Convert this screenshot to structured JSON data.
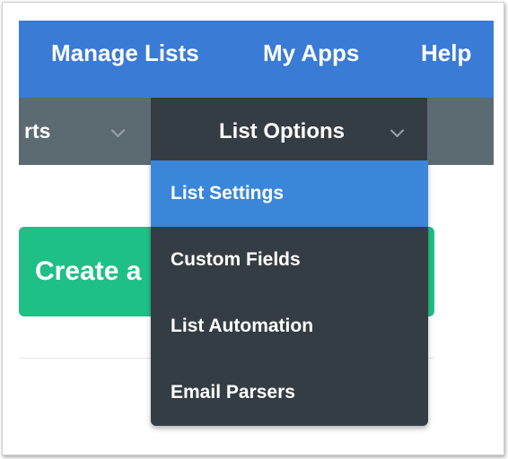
{
  "top_nav": {
    "items": [
      {
        "label": "Manage Lists"
      },
      {
        "label": "My Apps"
      },
      {
        "label": "Help"
      }
    ]
  },
  "sub_nav": {
    "partial_label": "rts",
    "active_label": "List Options",
    "chevron_icon": "chevron-down-icon"
  },
  "dropdown": {
    "items": [
      {
        "label": "List Settings",
        "active": true
      },
      {
        "label": "Custom Fields",
        "active": false
      },
      {
        "label": "List Automation",
        "active": false
      },
      {
        "label": "Email Parsers",
        "active": false
      }
    ]
  },
  "main": {
    "create_button_label": "Create a"
  },
  "colors": {
    "top_nav_bg": "#3a7bd5",
    "sub_nav_bg": "#5c6a72",
    "dropdown_bg": "#343d44",
    "active_item_bg": "#3a87d9",
    "create_button_bg": "#1fbf85"
  }
}
